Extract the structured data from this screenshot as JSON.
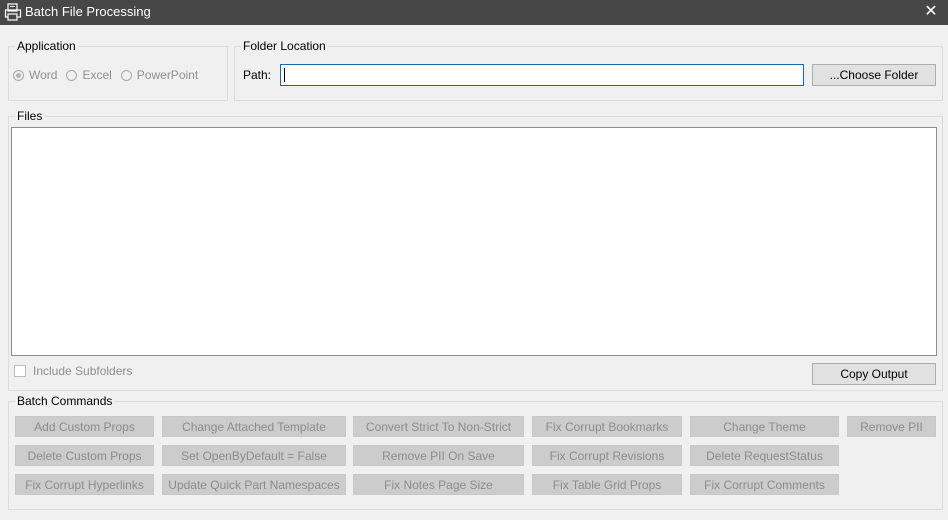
{
  "window": {
    "title": "Batch File Processing",
    "close_glyph": "✕",
    "app_icon": "printer-doc-icon"
  },
  "application": {
    "legend": "Application",
    "options": [
      {
        "label": "Word",
        "checked": true
      },
      {
        "label": "Excel",
        "checked": false
      },
      {
        "label": "PowerPoint",
        "checked": false
      }
    ]
  },
  "folder": {
    "legend": "Folder Location",
    "path_label": "Path:",
    "path_value": "",
    "choose_label": "...Choose Folder"
  },
  "files": {
    "legend": "Files",
    "include_subfolders_label": "Include Subfolders",
    "include_subfolders_checked": false,
    "copy_output_label": "Copy Output"
  },
  "batch": {
    "legend": "Batch Commands",
    "rows": [
      [
        "Add Custom Props",
        "Change Attached Template",
        "Convert Strict To Non-Strict",
        "Fix Corrupt Bookmarks",
        "Change Theme",
        "Remove PII"
      ],
      [
        "Delete Custom Props",
        "Set OpenByDefault = False",
        "Remove PII On Save",
        "Fix Corrupt Revisions",
        "Delete RequestStatus"
      ],
      [
        "Fix Corrupt Hyperlinks",
        "Update Quick Part Namespaces",
        "Fix Notes Page Size",
        "Fix Table Grid Props",
        "Fix Corrupt Comments"
      ]
    ]
  }
}
